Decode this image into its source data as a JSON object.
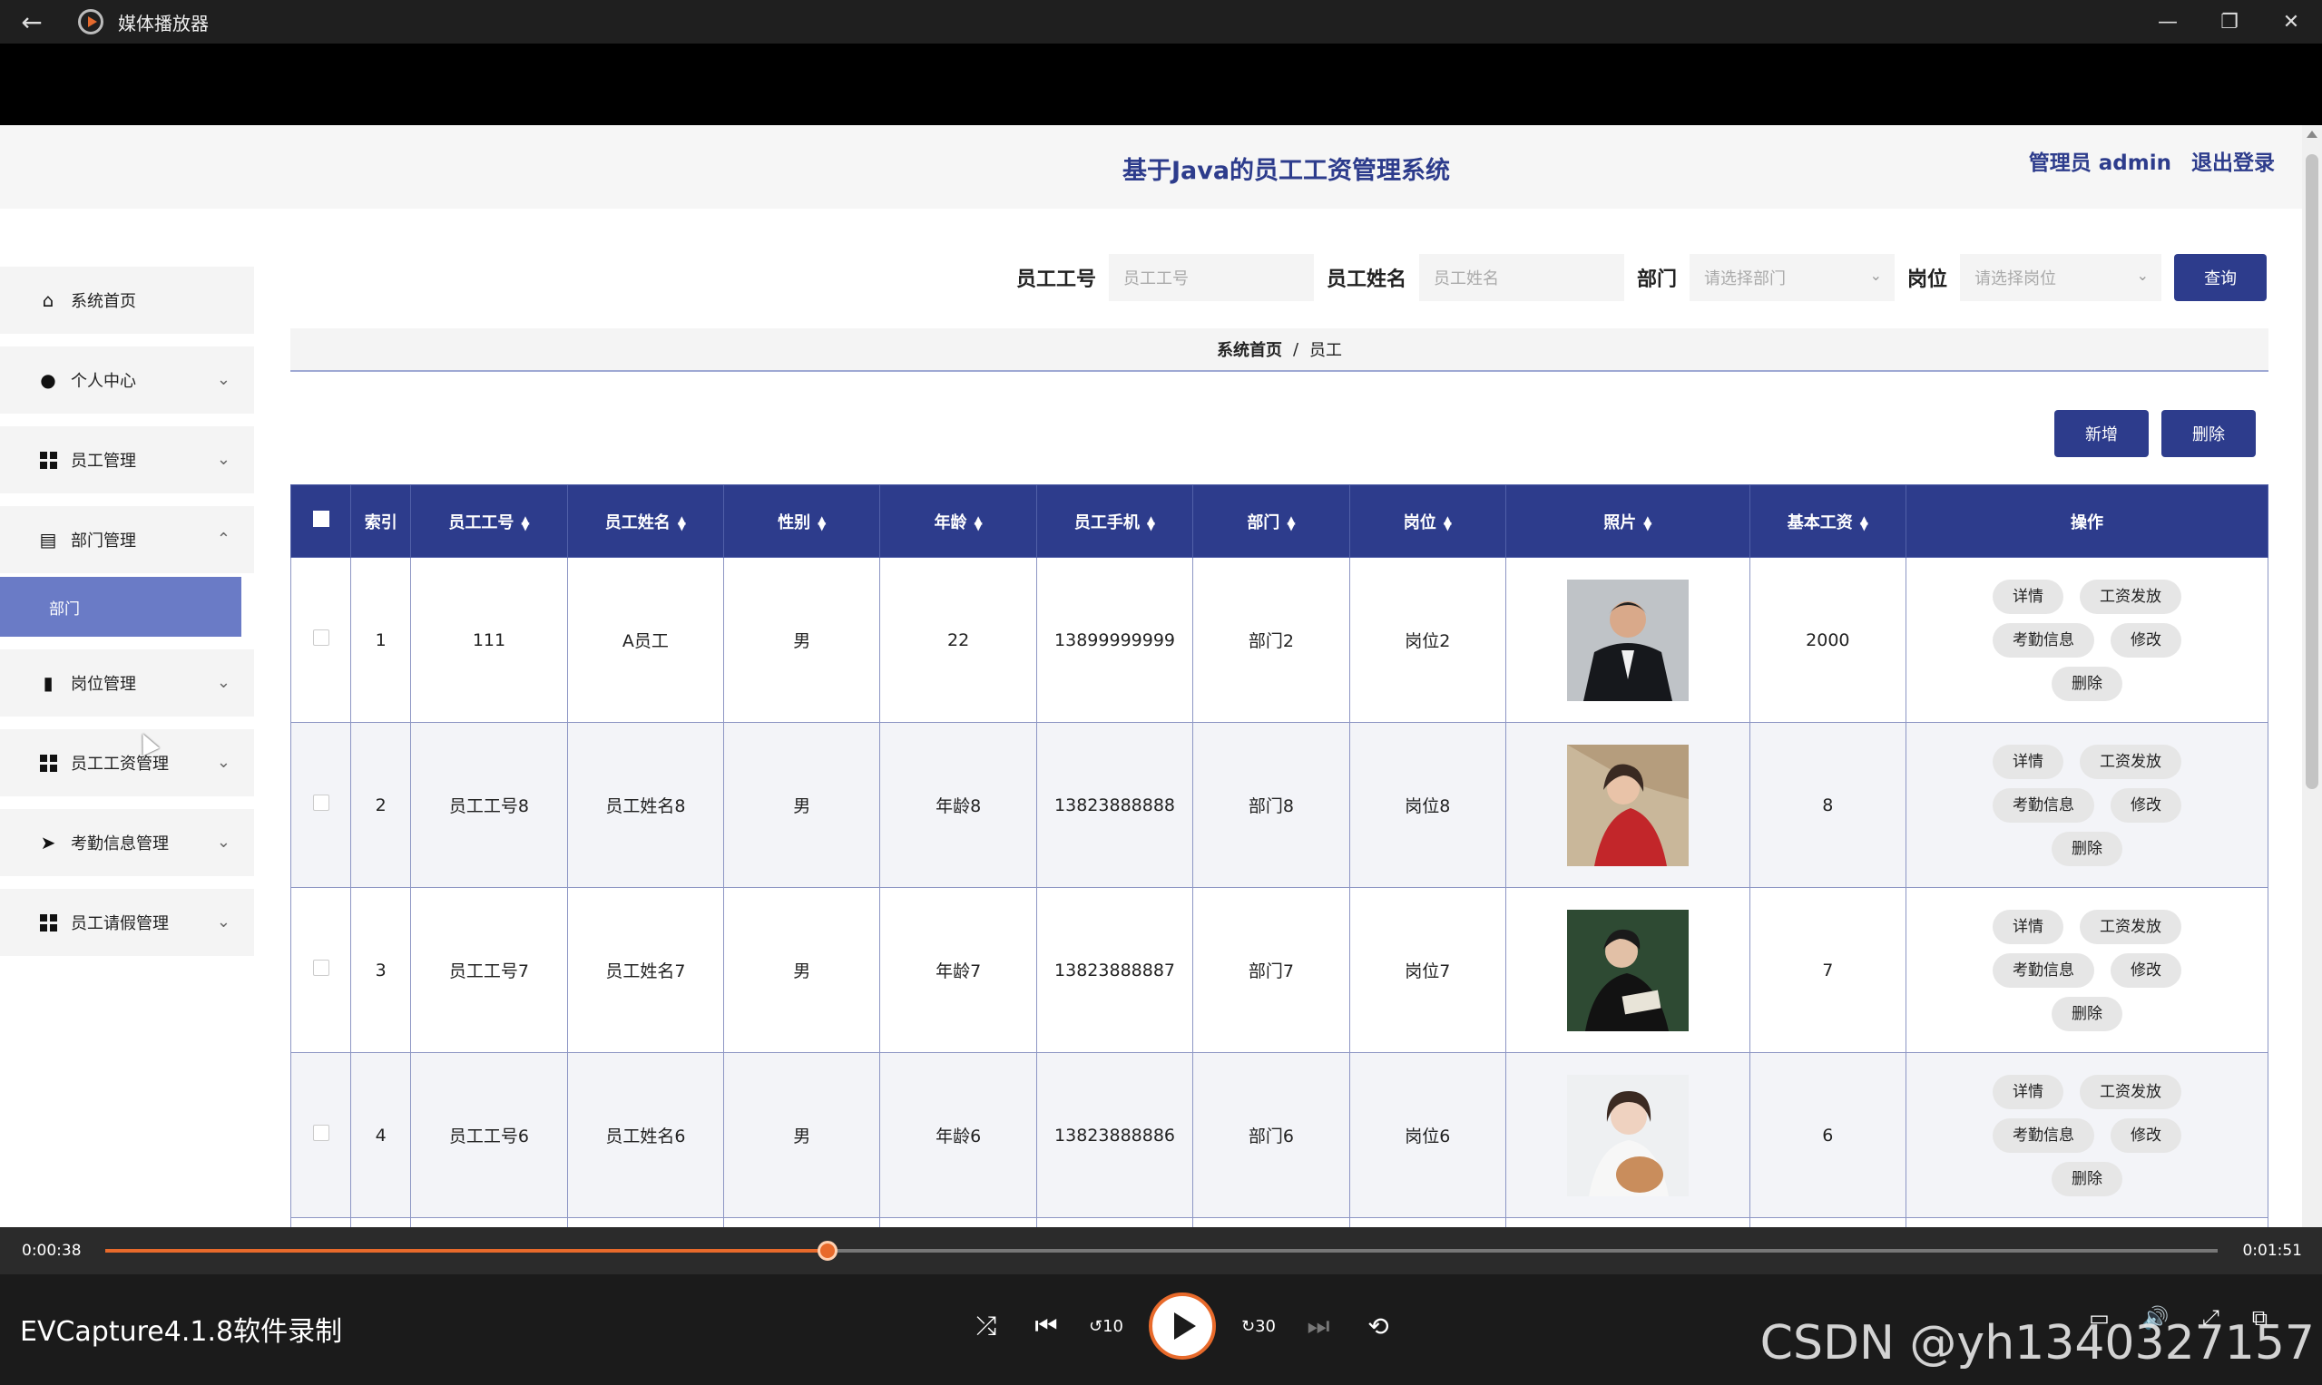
{
  "window": {
    "back_icon": "arrow-left-icon",
    "title": "媒体播放器",
    "controls": [
      "minimize-icon",
      "restore-icon",
      "close-icon"
    ]
  },
  "app": {
    "title": "基于Java的员工工资管理系统",
    "user_label": "管理员 admin",
    "logout_label": "退出登录"
  },
  "sidebar": {
    "items": [
      {
        "label": "系统首页",
        "icon": "home-icon",
        "chevron": ""
      },
      {
        "label": "个人中心",
        "icon": "user-icon",
        "chevron": "⌄"
      },
      {
        "label": "员工管理",
        "icon": "grid-icon",
        "chevron": "⌄"
      },
      {
        "label": "部门管理",
        "icon": "clipboard-icon",
        "chevron": "⌃"
      },
      {
        "label": "岗位管理",
        "icon": "bar-chart-icon",
        "chevron": "⌄"
      },
      {
        "label": "员工工资管理",
        "icon": "grid-icon",
        "chevron": "⌄"
      },
      {
        "label": "考勤信息管理",
        "icon": "send-icon",
        "chevron": "⌄"
      },
      {
        "label": "员工请假管理",
        "icon": "grid-icon",
        "chevron": "⌄"
      }
    ],
    "sub_item": "部门"
  },
  "search": {
    "id_label": "员工工号",
    "id_placeholder": "员工工号",
    "name_label": "员工姓名",
    "name_placeholder": "员工姓名",
    "dept_label": "部门",
    "dept_placeholder": "请选择部门",
    "post_label": "岗位",
    "post_placeholder": "请选择岗位",
    "query_label": "查询"
  },
  "breadcrumb": {
    "home": "系统首页",
    "sep": "/",
    "current": "员工"
  },
  "actions": {
    "add_label": "新增",
    "delete_label": "删除"
  },
  "table": {
    "headers": [
      "索引",
      "员工工号",
      "员工姓名",
      "性别",
      "年龄",
      "员工手机",
      "部门",
      "岗位",
      "照片",
      "基本工资",
      "操作"
    ],
    "rows": [
      {
        "index": "1",
        "emp_id": "111",
        "name": "A员工",
        "gender": "男",
        "age": "22",
        "phone": "13899999999",
        "dept": "部门2",
        "post": "岗位2",
        "salary": "2000"
      },
      {
        "index": "2",
        "emp_id": "员工工号8",
        "name": "员工姓名8",
        "gender": "男",
        "age": "年龄8",
        "phone": "13823888888",
        "dept": "部门8",
        "post": "岗位8",
        "salary": "8"
      },
      {
        "index": "3",
        "emp_id": "员工工号7",
        "name": "员工姓名7",
        "gender": "男",
        "age": "年龄7",
        "phone": "13823888887",
        "dept": "部门7",
        "post": "岗位7",
        "salary": "7"
      },
      {
        "index": "4",
        "emp_id": "员工工号6",
        "name": "员工姓名6",
        "gender": "男",
        "age": "年龄6",
        "phone": "13823888886",
        "dept": "部门6",
        "post": "岗位6",
        "salary": "6"
      }
    ],
    "op_buttons": {
      "detail": "详情",
      "pay": "工资发放",
      "attendance": "考勤信息",
      "edit": "修改",
      "delete": "删除"
    }
  },
  "player": {
    "elapsed": "0:00:38",
    "total": "0:01:51",
    "progress": 0.342,
    "media_title": "EVCapture4.1.8软件录制",
    "watermark": "CSDN @yh1340327157",
    "skip_back": "10",
    "skip_forward": "30",
    "accent": "#e86a2b"
  },
  "colors": {
    "primary": "#2d3c8c",
    "submenu_active": "#6a7bc6"
  }
}
